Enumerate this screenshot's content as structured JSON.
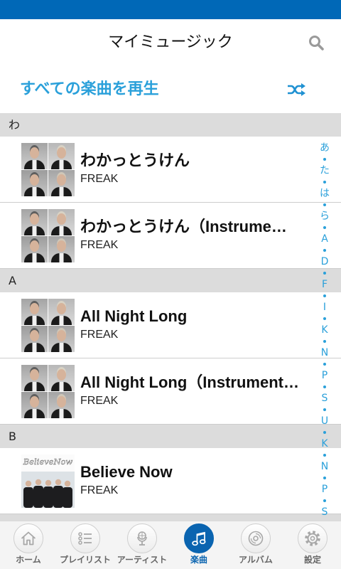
{
  "colors": {
    "status_bar": "#0068b7",
    "accent": "#0a64b0",
    "link": "#2aa0da",
    "section_bg": "#dcdcdc"
  },
  "header": {
    "title": "マイミュージック",
    "search_icon": "search-icon"
  },
  "play_all": {
    "label": "すべての楽曲を再生",
    "icon": "shuffle-icon"
  },
  "sections": [
    {
      "header": "わ",
      "songs": [
        {
          "title": "わかっとうけん",
          "artist": "FREAK"
        },
        {
          "title": "わかっとうけん（Instrume…",
          "artist": "FREAK"
        }
      ]
    },
    {
      "header": "A",
      "songs": [
        {
          "title": "All Night Long",
          "artist": "FREAK"
        },
        {
          "title": "All Night Long（Instrument…",
          "artist": "FREAK"
        }
      ]
    },
    {
      "header": "B",
      "songs": [
        {
          "title": "Believe Now",
          "artist": "FREAK",
          "art_text": "BelieveNow"
        }
      ]
    }
  ],
  "index": [
    "あ",
    "た",
    "は",
    "ら",
    "A",
    "D",
    "F",
    "I",
    "K",
    "N",
    "P",
    "S",
    "U",
    "K",
    "N",
    "P",
    "S"
  ],
  "tabs": [
    {
      "label": "ホーム",
      "icon": "home-icon",
      "active": false
    },
    {
      "label": "プレイリスト",
      "icon": "playlist-icon",
      "active": false
    },
    {
      "label": "アーティスト",
      "icon": "microphone-icon",
      "active": false
    },
    {
      "label": "楽曲",
      "icon": "music-note-icon",
      "active": true
    },
    {
      "label": "アルバム",
      "icon": "album-disc-icon",
      "active": false
    },
    {
      "label": "設定",
      "icon": "gear-icon",
      "active": false
    }
  ]
}
